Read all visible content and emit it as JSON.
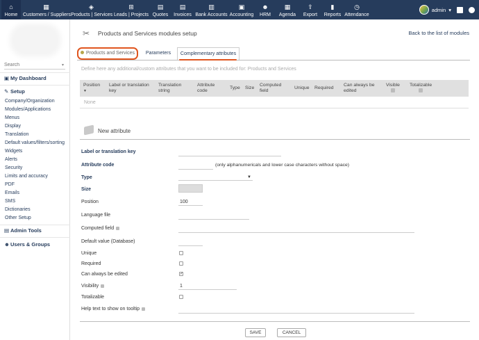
{
  "topnav": {
    "items": [
      {
        "label": "Home",
        "icon": "home-icon"
      },
      {
        "label": "Customers / Suppliers",
        "icon": "building-icon"
      },
      {
        "label": "Products | Services",
        "icon": "cube-icon"
      },
      {
        "label": "Leads | Projects",
        "icon": "sitemap-icon"
      },
      {
        "label": "Quotes",
        "icon": "file-icon"
      },
      {
        "label": "Invoices",
        "icon": "invoice-icon"
      },
      {
        "label": "Bank Accounts",
        "icon": "bank-icon"
      },
      {
        "label": "Accounting",
        "icon": "calculator-icon"
      },
      {
        "label": "HRM",
        "icon": "user-tie-icon"
      },
      {
        "label": "Agenda",
        "icon": "calendar-icon"
      },
      {
        "label": "Export",
        "icon": "export-icon"
      },
      {
        "label": "Reports",
        "icon": "chart-icon"
      },
      {
        "label": "Attendance",
        "icon": "clock-icon"
      }
    ],
    "user": "admin"
  },
  "sidebar": {
    "search_placeholder": "Search",
    "dashboard": "My Dashboard",
    "setup": "Setup",
    "setup_items": [
      "Company/Organization",
      "Modules/Applications",
      "Menus",
      "Display",
      "Translation",
      "Default values/filters/sorting",
      "Widgets",
      "Alerts",
      "Security",
      "Limits and accuracy",
      "PDF",
      "Emails",
      "SMS",
      "Dictionaries",
      "Other Setup"
    ],
    "admin_tools": "Admin Tools",
    "users_groups": "Users & Groups"
  },
  "page": {
    "title": "Products and Services modules setup",
    "back_link": "Back to the list of modules",
    "tabs": [
      "Products and Services",
      "Parameters",
      "Complementary attributes"
    ],
    "intro": "Define here any additional/custom attributes that you want to be included for: Products and Services"
  },
  "table": {
    "headers": {
      "position": "Position",
      "label": "Label or translation key",
      "translation": "Translation string",
      "attribute_code": "Attribute code",
      "type": "Type",
      "size": "Size",
      "computed": "Computed field",
      "unique": "Unique",
      "required": "Required",
      "always_edited": "Can always be edited",
      "visible": "Visible",
      "totalizable": "Totalizable"
    },
    "empty": "None"
  },
  "form": {
    "title": "New attribute",
    "label_key": "Label or translation key",
    "attribute_code": "Attribute code",
    "attribute_code_note": "(only alphanumericals and lower case characters without space)",
    "type": "Type",
    "size": "Size",
    "position": "Position",
    "position_value": "100",
    "language_file": "Language file",
    "computed_field": "Computed field",
    "default_value": "Default value (Database)",
    "unique": "Unique",
    "required": "Required",
    "always_edited": "Can always be edited",
    "visibility": "Visibility",
    "visibility_value": "1",
    "totalizable": "Totalizable",
    "help_text": "Help text to show on tooltip",
    "save": "SAVE",
    "cancel": "CANCEL"
  }
}
